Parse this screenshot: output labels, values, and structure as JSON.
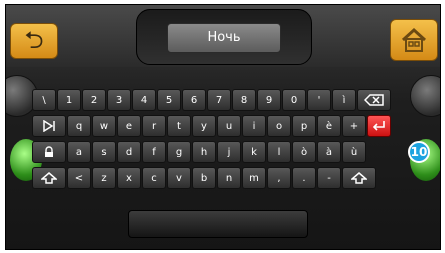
{
  "header": {
    "title": "Ночь",
    "back_icon": "back-arrow-icon",
    "home_icon": "home-icon"
  },
  "keyboard": {
    "row1": [
      "\\",
      "1",
      "2",
      "3",
      "4",
      "5",
      "6",
      "7",
      "8",
      "9",
      "0",
      "'",
      "ì",
      "backspace"
    ],
    "row2": [
      "tab",
      "q",
      "w",
      "e",
      "r",
      "t",
      "y",
      "u",
      "i",
      "o",
      "p",
      "è",
      "+",
      "enter"
    ],
    "row3": [
      "caps",
      "a",
      "s",
      "d",
      "f",
      "g",
      "h",
      "j",
      "k",
      "l",
      "ò",
      "à",
      "ù"
    ],
    "row4": [
      "shift",
      "<",
      "z",
      "x",
      "c",
      "v",
      "b",
      "n",
      "m",
      ",",
      ".",
      "-",
      "shift"
    ]
  },
  "badge": "10",
  "accent_colors": {
    "orange": "#e3a030",
    "red": "#e02020",
    "blue": "#1da3e0",
    "green": "#3cae2a"
  }
}
